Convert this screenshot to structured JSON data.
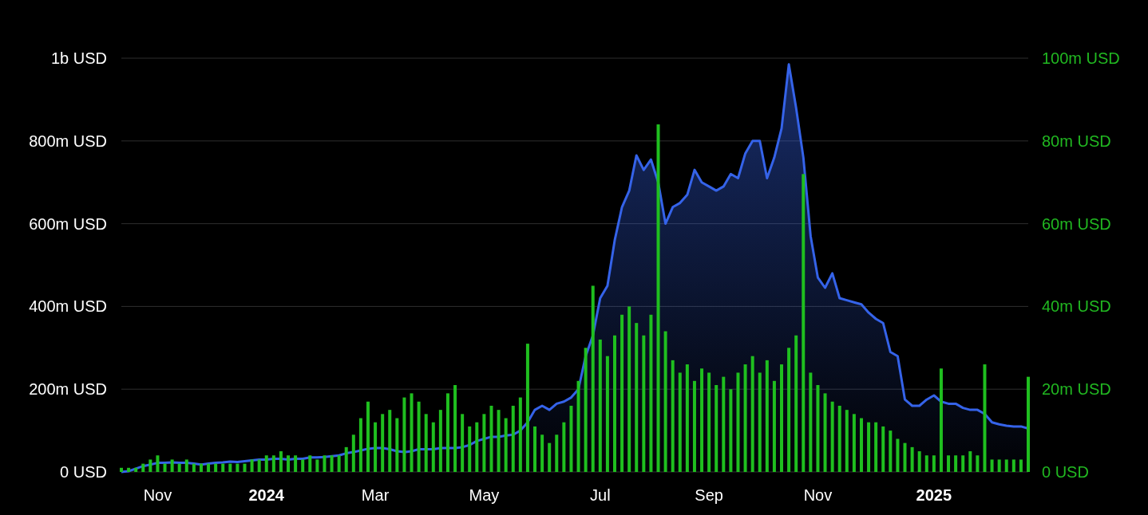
{
  "chart_data": {
    "type": "area",
    "grid": true,
    "categories": [
      null,
      null,
      null,
      null,
      null,
      "Nov",
      null,
      null,
      null,
      null,
      null,
      null,
      null,
      null,
      null,
      null,
      null,
      null,
      null,
      null,
      "2024",
      null,
      null,
      null,
      null,
      null,
      null,
      null,
      null,
      null,
      null,
      null,
      null,
      null,
      null,
      "Mar",
      null,
      null,
      null,
      null,
      null,
      null,
      null,
      null,
      null,
      null,
      null,
      null,
      null,
      null,
      "May",
      null,
      null,
      null,
      null,
      null,
      null,
      null,
      null,
      null,
      null,
      null,
      null,
      null,
      null,
      null,
      "Jul",
      null,
      null,
      null,
      null,
      null,
      null,
      null,
      null,
      null,
      null,
      null,
      null,
      null,
      null,
      "Sep",
      null,
      null,
      null,
      null,
      null,
      null,
      null,
      null,
      null,
      null,
      null,
      null,
      null,
      null,
      "Nov",
      null,
      null,
      null,
      null,
      null,
      null,
      null,
      null,
      null,
      null,
      null,
      null,
      null,
      null,
      null,
      "2025",
      null,
      null,
      null,
      null,
      null,
      null,
      null,
      null,
      null,
      null,
      null,
      null,
      null
    ],
    "ylim": [
      0,
      1000000000
    ],
    "yticks": [
      {
        "value": 0,
        "label": "0 USD"
      },
      {
        "value": 200000000,
        "label": "200m USD"
      },
      {
        "value": 400000000,
        "label": "400m USD"
      },
      {
        "value": 600000000,
        "label": "600m USD"
      },
      {
        "value": 800000000,
        "label": "800m USD"
      },
      {
        "value": 1000000000,
        "label": "1b USD"
      }
    ],
    "y2lim": [
      0,
      100000000
    ],
    "y2ticks": [
      {
        "value": 0,
        "label": "0 USD"
      },
      {
        "value": 20000000,
        "label": "20m USD"
      },
      {
        "value": 40000000,
        "label": "40m USD"
      },
      {
        "value": 60000000,
        "label": "60m USD"
      },
      {
        "value": 80000000,
        "label": "80m USD"
      },
      {
        "value": 100000000,
        "label": "100m USD"
      }
    ],
    "series": [
      {
        "color": "#3563e9",
        "values": [
          0,
          2000000,
          8000000,
          14000000,
          18000000,
          22000000,
          22000000,
          23000000,
          22000000,
          22000000,
          20000000,
          18000000,
          20000000,
          22000000,
          23000000,
          25000000,
          24000000,
          26000000,
          28000000,
          30000000,
          30000000,
          32000000,
          32000000,
          30000000,
          32000000,
          32000000,
          35000000,
          35000000,
          36000000,
          38000000,
          40000000,
          45000000,
          48000000,
          52000000,
          56000000,
          58000000,
          58000000,
          55000000,
          50000000,
          48000000,
          50000000,
          55000000,
          55000000,
          55000000,
          58000000,
          58000000,
          58000000,
          60000000,
          65000000,
          75000000,
          80000000,
          85000000,
          85000000,
          88000000,
          90000000,
          100000000,
          120000000,
          150000000,
          160000000,
          150000000,
          165000000,
          170000000,
          180000000,
          200000000,
          280000000,
          330000000,
          420000000,
          450000000,
          560000000,
          640000000,
          680000000,
          765000000,
          730000000,
          755000000,
          700000000,
          600000000,
          640000000,
          650000000,
          670000000,
          730000000,
          700000000,
          690000000,
          680000000,
          690000000,
          720000000,
          710000000,
          770000000,
          800000000,
          800000000,
          710000000,
          760000000,
          830000000,
          985000000,
          880000000,
          760000000,
          570000000,
          470000000,
          445000000,
          480000000,
          420000000,
          415000000,
          410000000,
          405000000,
          385000000,
          370000000,
          360000000,
          290000000,
          280000000,
          175000000,
          160000000,
          160000000,
          175000000,
          185000000,
          170000000,
          165000000,
          165000000,
          155000000,
          150000000,
          150000000,
          140000000,
          120000000,
          115000000,
          112000000,
          110000000,
          110000000,
          105000000
        ]
      },
      {
        "type": "bar",
        "axis": "y2",
        "color": "#1fbf1f",
        "values": [
          1000000,
          1000000,
          1000000,
          2000000,
          3000000,
          4000000,
          2000000,
          3000000,
          2000000,
          3000000,
          2000000,
          2000000,
          2000000,
          2000000,
          2000000,
          2000000,
          2000000,
          2000000,
          3000000,
          3000000,
          4000000,
          4000000,
          5000000,
          4000000,
          4000000,
          3000000,
          4000000,
          3000000,
          4000000,
          4000000,
          4000000,
          6000000,
          9000000,
          13000000,
          17000000,
          12000000,
          14000000,
          15000000,
          13000000,
          18000000,
          19000000,
          17000000,
          14000000,
          12000000,
          15000000,
          19000000,
          21000000,
          14000000,
          11000000,
          12000000,
          14000000,
          16000000,
          15000000,
          13000000,
          16000000,
          18000000,
          31000000,
          11000000,
          9000000,
          7000000,
          9000000,
          12000000,
          16000000,
          22000000,
          30000000,
          45000000,
          32000000,
          28000000,
          33000000,
          38000000,
          40000000,
          36000000,
          33000000,
          38000000,
          84000000,
          34000000,
          27000000,
          24000000,
          26000000,
          22000000,
          25000000,
          24000000,
          21000000,
          23000000,
          20000000,
          24000000,
          26000000,
          28000000,
          24000000,
          27000000,
          22000000,
          26000000,
          30000000,
          33000000,
          72000000,
          24000000,
          21000000,
          19000000,
          17000000,
          16000000,
          15000000,
          14000000,
          13000000,
          12000000,
          12000000,
          11000000,
          10000000,
          8000000,
          7000000,
          6000000,
          5000000,
          4000000,
          4000000,
          25000000,
          4000000,
          4000000,
          4000000,
          5000000,
          4000000,
          26000000,
          3000000,
          3000000,
          3000000,
          3000000,
          3000000,
          23000000
        ]
      }
    ]
  }
}
